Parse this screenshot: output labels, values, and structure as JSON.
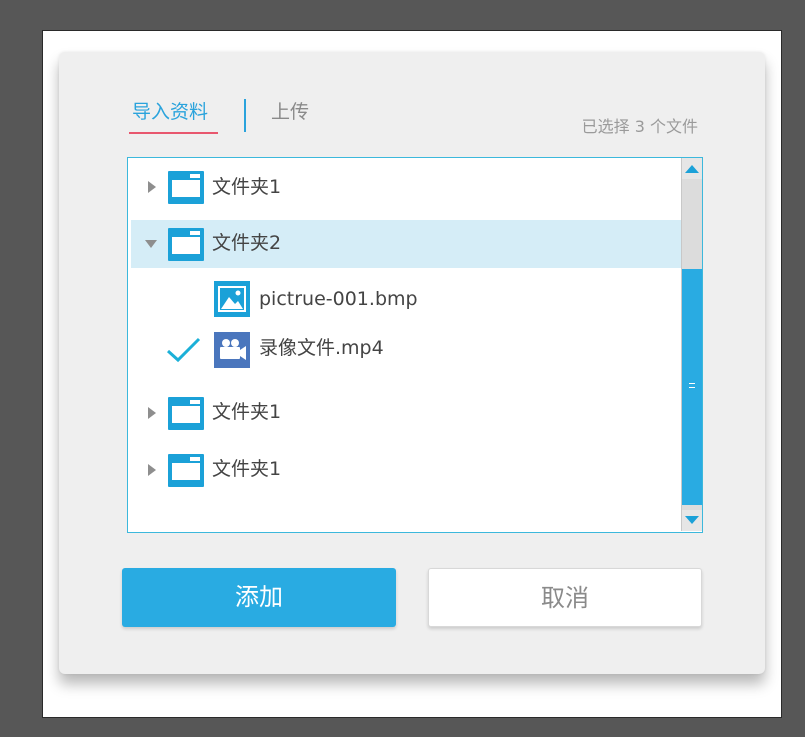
{
  "tabs": {
    "import_label": "导入资料",
    "upload_label": "上传"
  },
  "selected_count_text": "已选择 3 个文件",
  "tree": {
    "items": [
      {
        "label": "文件夹1",
        "type": "folder",
        "expanded": false
      },
      {
        "label": "文件夹2",
        "type": "folder",
        "expanded": true
      },
      {
        "label": "pictrue-001.bmp",
        "type": "image-file",
        "checked": false
      },
      {
        "label": "录像文件.mp4",
        "type": "video-file",
        "checked": true
      },
      {
        "label": "文件夹1",
        "type": "folder",
        "expanded": false
      },
      {
        "label": "文件夹1",
        "type": "folder",
        "expanded": false
      }
    ]
  },
  "buttons": {
    "add_label": "添加",
    "cancel_label": "取消"
  },
  "colors": {
    "accent": "#29abe2",
    "tab_underline": "#e8576e",
    "highlight_row": "#d5edf7"
  }
}
